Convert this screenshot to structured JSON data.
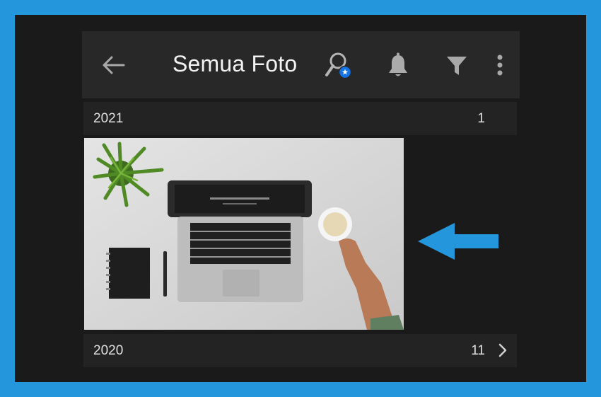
{
  "header": {
    "title": "Semua Foto",
    "back_icon": "arrow-left-icon",
    "icons": [
      "search-person-star-icon",
      "bell-icon",
      "filter-icon",
      "more-vertical-icon"
    ]
  },
  "sections": [
    {
      "year": "2021",
      "count": "1",
      "has_chevron": false
    },
    {
      "year": "2020",
      "count": "11",
      "has_chevron": true
    }
  ],
  "photo": {
    "subject": "laptop-desk-photo"
  },
  "colors": {
    "border": "#2496dc",
    "background": "#1a1a1a",
    "header_bg": "#282828",
    "arrow": "#2496dc",
    "badge": "#1473e6"
  }
}
